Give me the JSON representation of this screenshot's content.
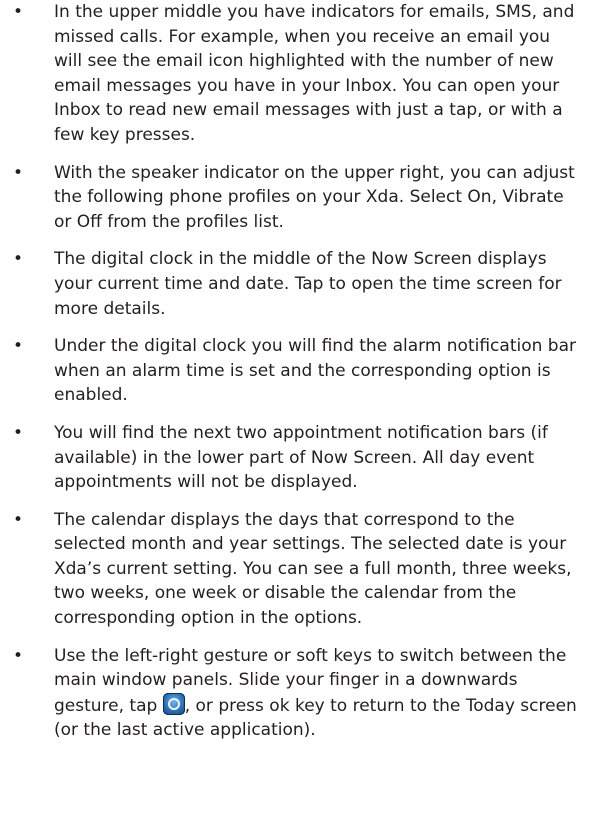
{
  "bullets": [
    {
      "text": "In the upper middle you have indicators for emails, SMS, and missed calls. For example, when you receive an email you will see the email icon highlighted with the number of new email messages you have in your Inbox. You can open your Inbox to read new email messages with just a tap, or with a few key presses."
    },
    {
      "text": "With the speaker indicator on the upper right, you can adjust the following phone profiles on your Xda. Select On, Vibrate or Off from the profiles list."
    },
    {
      "text": "The digital clock in the middle of the Now Screen displays your current time and date. Tap to open the time screen for more details."
    },
    {
      "text": "Under the digital clock you will find the alarm notification bar when an alarm time is set and the corresponding option is enabled."
    },
    {
      "text": "You will find the next two appointment notification bars (if available) in the lower part of Now Screen. All day event appointments will not be displayed."
    },
    {
      "text": "The calendar displays the days that correspond to the selected month and year settings. The selected date is your Xda’s current setting. You can see a full month, three weeks, two weeks, one week or disable the calendar from the corresponding option in the options."
    },
    {
      "text_before": "Use the left-right gesture or soft keys to switch between the main window panels. Slide your finger in a downwards gesture, tap",
      "icon": "today-home-icon",
      "text_after": ", or press ok key to return to the Today screen (or the last active application)."
    }
  ]
}
